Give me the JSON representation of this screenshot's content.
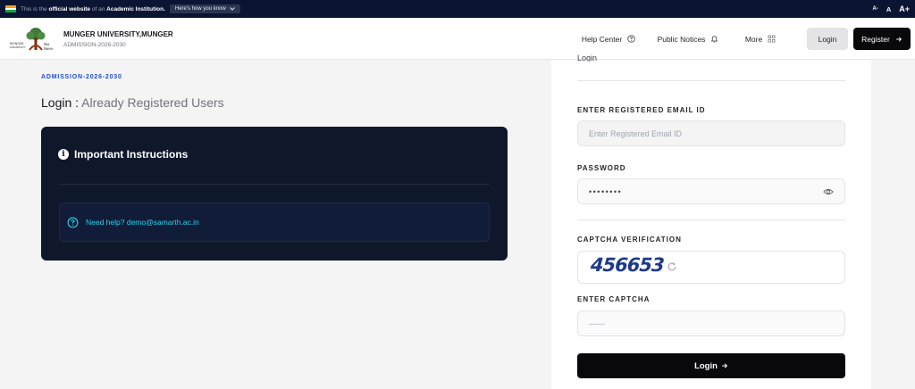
{
  "govbar": {
    "text_prefix": "This is the",
    "text_bold1": "official website",
    "text_mid": "of an",
    "text_bold2": "Academic Institution.",
    "how_label": "Here's how you know",
    "font_small": "A-",
    "font_normal": "A",
    "font_large": "A+"
  },
  "header": {
    "university_name": "MUNGER UNIVERSITY,MUNGER",
    "subtitle": "ADMISSION-2026-2030",
    "nav": {
      "help_center": "Help Center",
      "public_notices": "Public Notices",
      "more": "More",
      "login": "Login",
      "register": "Register"
    }
  },
  "main": {
    "admission_label": "ADMISSION-2026-2030",
    "login_heading_prefix": "Login :",
    "login_heading_rest": "Already Registered Users",
    "instructions_title": "Important Instructions",
    "help_text": "Need help? demo@samarth.ac.in"
  },
  "form": {
    "heading_cut": "Login",
    "email_label": "ENTER REGISTERED EMAIL ID",
    "email_placeholder": "Enter Registered Email ID",
    "email_value": "",
    "password_label": "PASSWORD",
    "password_value": "••••••••",
    "captcha_label": "CAPTCHA VERIFICATION",
    "captcha_text": "456653",
    "enter_captcha_label": "ENTER CAPTCHA",
    "captcha_placeholder": "------",
    "submit_label": "Login"
  },
  "colors": {
    "accent_blue": "#1d4ed8",
    "dark_card": "#0f172a",
    "help_cyan": "#22d3ee",
    "button_black": "#09090b"
  }
}
